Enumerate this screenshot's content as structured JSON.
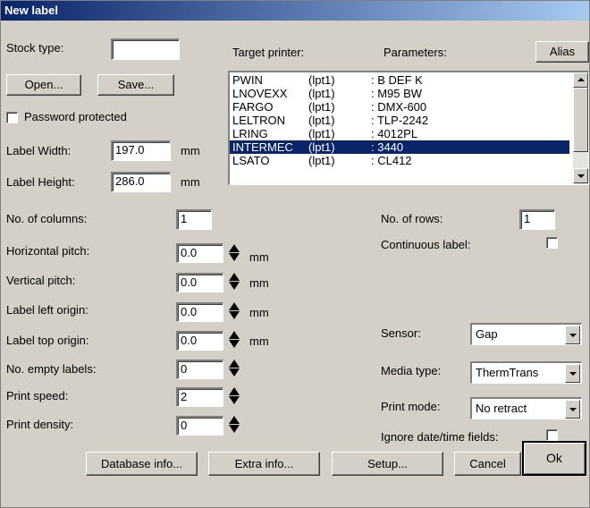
{
  "window": {
    "title": "New label"
  },
  "left": {
    "stock_type_label": "Stock type:",
    "stock_type_value": "",
    "open_button": "Open...",
    "save_button": "Save...",
    "password_label": "Password protected",
    "label_width_label": "Label Width:",
    "label_width_value": "197.0",
    "label_height_label": "Label Height:",
    "label_height_value": "286.0",
    "unit_mm": "mm"
  },
  "printer": {
    "target_label": "Target printer:",
    "parameters_label": "Parameters:",
    "alias_button": "Alias",
    "rows": [
      {
        "name": "PWIN",
        "port": "(lpt1)",
        "param": ": B DEF K",
        "selected": false
      },
      {
        "name": "LNOVEXX",
        "port": "(lpt1)",
        "param": ": M95 BW",
        "selected": false
      },
      {
        "name": "FARGO",
        "port": "(lpt1)",
        "param": ": DMX-600",
        "selected": false
      },
      {
        "name": "LELTRON",
        "port": "(lpt1)",
        "param": ": TLP-2242",
        "selected": false
      },
      {
        "name": "LRING",
        "port": "(lpt1)",
        "param": ": 4012PL",
        "selected": false
      },
      {
        "name": "INTERMEC",
        "port": "(lpt1)",
        "param": ": 3440",
        "selected": true
      },
      {
        "name": "LSATO",
        "port": "(lpt1)",
        "param": ": CL412",
        "selected": false
      }
    ]
  },
  "layout": {
    "columns_label": "No. of columns:",
    "columns_value": "1",
    "rows_label": "No. of rows:",
    "rows_value": "1",
    "continuous_label": "Continuous label:",
    "hpitch_label": "Horizontal pitch:",
    "hpitch_value": "0.0",
    "vpitch_label": "Vertical pitch:",
    "vpitch_value": "0.0",
    "left_origin_label": "Label left origin:",
    "left_origin_value": "0.0",
    "top_origin_label": "Label top origin:",
    "top_origin_value": "0.0",
    "empty_labels_label": "No. empty labels:",
    "empty_labels_value": "0",
    "speed_label": "Print speed:",
    "speed_value": "2",
    "density_label": "Print density:",
    "density_value": "0",
    "unit_mm": "mm"
  },
  "options": {
    "sensor_label": "Sensor:",
    "sensor_value": "Gap",
    "media_label": "Media type:",
    "media_value": "ThermTrans",
    "print_mode_label": "Print mode:",
    "print_mode_value": "No retract",
    "ignore_dates_label": "Ignore date/time fields:"
  },
  "footer": {
    "database_button": "Database info...",
    "extra_button": "Extra info...",
    "setup_button": "Setup...",
    "cancel_button": "Cancel",
    "ok_button": "Ok"
  }
}
